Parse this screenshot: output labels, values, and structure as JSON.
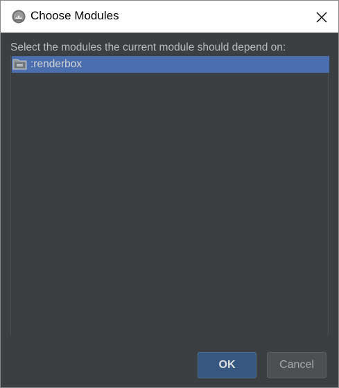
{
  "dialog": {
    "title": "Choose Modules",
    "prompt": "Select the modules the current module should depend on:",
    "modules": [
      {
        "label": ":renderbox",
        "selected": true,
        "icon": "module-folder-icon"
      }
    ],
    "ok_label": "OK",
    "cancel_label": "Cancel"
  },
  "colors": {
    "background": "#3c3f41",
    "selection": "#4b6eaf",
    "primary_button": "#365880",
    "secondary_button": "#4c5052",
    "text": "#bbbbbb"
  }
}
